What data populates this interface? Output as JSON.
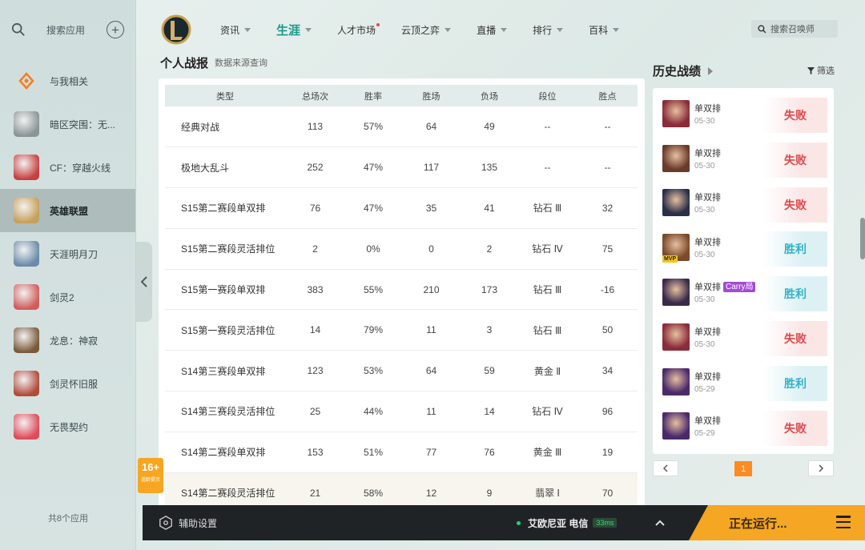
{
  "sidebar": {
    "search_label": "搜索应用",
    "items": [
      {
        "label": "与我相关",
        "icon": "related-icon",
        "color": "#ff7a1a"
      },
      {
        "label": "暗区突围：无...",
        "icon": "game-arena-breakout-icon",
        "color": "#8a9496"
      },
      {
        "label": "CF：穿越火线",
        "icon": "game-cf-icon",
        "color": "#c74040"
      },
      {
        "label": "英雄联盟",
        "icon": "game-lol-icon",
        "color": "#c6a15b"
      },
      {
        "label": "天涯明月刀",
        "icon": "game-tym-icon",
        "color": "#6b8ba8"
      },
      {
        "label": "剑灵2",
        "icon": "game-bns2-icon",
        "color": "#d15c5c"
      },
      {
        "label": "龙息：神寂",
        "icon": "game-dragon-icon",
        "color": "#7a5a3a"
      },
      {
        "label": "剑灵怀旧服",
        "icon": "game-bns-classic-icon",
        "color": "#b14a3a"
      },
      {
        "label": "无畏契约",
        "icon": "game-valorant-icon",
        "color": "#e04a5a"
      }
    ],
    "active_index": 3,
    "footer": "共8个应用"
  },
  "nav": {
    "items": [
      {
        "label": "资讯",
        "caret": true,
        "dot": false
      },
      {
        "label": "生涯",
        "caret": true,
        "dot": false
      },
      {
        "label": "人才市场",
        "caret": false,
        "dot": true
      },
      {
        "label": "云顶之弈",
        "caret": true,
        "dot": false
      },
      {
        "label": "直播",
        "caret": true,
        "dot": false
      },
      {
        "label": "排行",
        "caret": true,
        "dot": false
      },
      {
        "label": "百科",
        "caret": true,
        "dot": false
      }
    ],
    "active_index": 1,
    "search_placeholder": "搜索召唤师"
  },
  "section": {
    "title": "个人战报",
    "subtitle": "数据来源查询"
  },
  "stats_table": {
    "headers": [
      "类型",
      "总场次",
      "胜率",
      "胜场",
      "负场",
      "段位",
      "胜点"
    ],
    "rows": [
      [
        "经典对战",
        "113",
        "57%",
        "64",
        "49",
        "--",
        "--"
      ],
      [
        "极地大乱斗",
        "252",
        "47%",
        "117",
        "135",
        "--",
        "--"
      ],
      [
        "S15第二赛段单双排",
        "76",
        "47%",
        "35",
        "41",
        "钻石 Ⅲ",
        "32"
      ],
      [
        "S15第二赛段灵活排位",
        "2",
        "0%",
        "0",
        "2",
        "钻石 Ⅳ",
        "75"
      ],
      [
        "S15第一赛段单双排",
        "383",
        "55%",
        "210",
        "173",
        "钻石 Ⅲ",
        "-16"
      ],
      [
        "S15第一赛段灵活排位",
        "14",
        "79%",
        "11",
        "3",
        "钻石 Ⅲ",
        "50"
      ],
      [
        "S14第三赛段单双排",
        "123",
        "53%",
        "64",
        "59",
        "黄金 Ⅱ",
        "34"
      ],
      [
        "S14第三赛段灵活排位",
        "25",
        "44%",
        "11",
        "14",
        "钻石 Ⅳ",
        "96"
      ],
      [
        "S14第二赛段单双排",
        "153",
        "51%",
        "77",
        "76",
        "黄金 Ⅲ",
        "19"
      ],
      [
        "S14第二赛段灵活排位",
        "21",
        "58%",
        "12",
        "9",
        "翡翠 Ⅰ",
        "70"
      ]
    ]
  },
  "history": {
    "title": "历史战绩",
    "filter_label": "筛选",
    "matches": [
      {
        "queue": "单双排",
        "date": "05-30",
        "result": "失败",
        "win": false,
        "carry": "",
        "mvp": "",
        "champ_color": "#8b2c3a"
      },
      {
        "queue": "单双排",
        "date": "05-30",
        "result": "失败",
        "win": false,
        "carry": "",
        "mvp": "",
        "champ_color": "#6a3a2a"
      },
      {
        "queue": "单双排",
        "date": "05-30",
        "result": "失败",
        "win": false,
        "carry": "",
        "mvp": "",
        "champ_color": "#2a2f4a"
      },
      {
        "queue": "单双排",
        "date": "05-30",
        "result": "胜利",
        "win": true,
        "carry": "",
        "mvp": "MVP",
        "champ_color": "#7a4a2a"
      },
      {
        "queue": "单双排",
        "date": "05-30",
        "result": "胜利",
        "win": true,
        "carry": "Carry局",
        "mvp": "",
        "champ_color": "#3a2a4a"
      },
      {
        "queue": "单双排",
        "date": "05-30",
        "result": "失败",
        "win": false,
        "carry": "",
        "mvp": "",
        "champ_color": "#8b2c3a"
      },
      {
        "queue": "单双排",
        "date": "05-29",
        "result": "胜利",
        "win": true,
        "carry": "",
        "mvp": "",
        "champ_color": "#4a2a6a"
      },
      {
        "queue": "单双排",
        "date": "05-29",
        "result": "失败",
        "win": false,
        "carry": "",
        "mvp": "",
        "champ_color": "#4a2a6a"
      }
    ],
    "page": "1"
  },
  "age_badge": {
    "age": "16+",
    "note": "适龄提示"
  },
  "bottom": {
    "assist_label": "辅助设置",
    "server": "艾欧尼亚 电信",
    "ping": "33ms",
    "running_label": "正在运行..."
  }
}
